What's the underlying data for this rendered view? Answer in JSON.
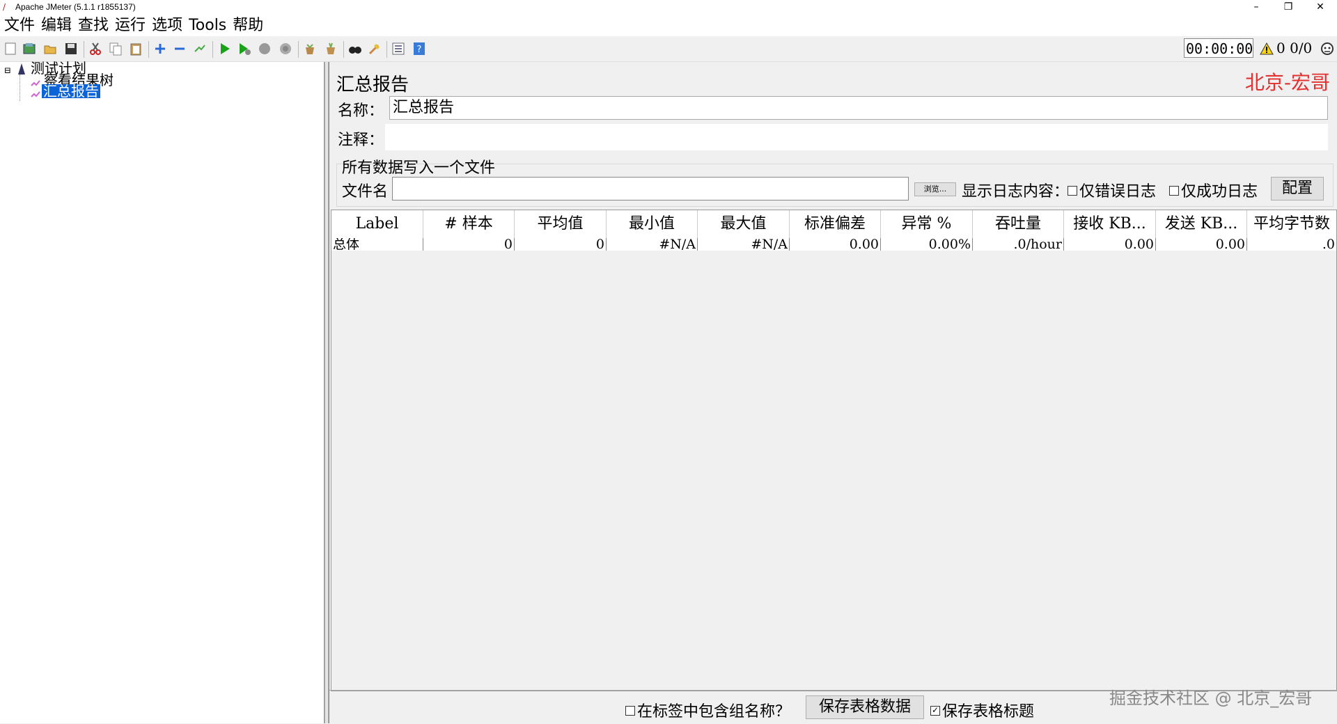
{
  "window": {
    "title": "Apache JMeter (5.1.1 r1855137)",
    "buttons": {
      "minimize": "–",
      "restore": "❐",
      "close": "✕"
    }
  },
  "menu": [
    "文件",
    "编辑",
    "查找",
    "运行",
    "选项",
    "Tools",
    "帮助"
  ],
  "toolbar": {
    "icons": [
      "new-icon",
      "templates-icon",
      "open-icon",
      "save-icon",
      "cut-icon",
      "copy-icon",
      "paste-icon",
      "expand-icon",
      "collapse-icon",
      "toggle-icon",
      "start-icon",
      "start-no-pauses-icon",
      "stop-icon",
      "shutdown-icon",
      "clear-icon",
      "clear-all-icon",
      "search-icon",
      "reset-search-icon",
      "function-helper-icon",
      "help-icon"
    ],
    "timer": "00:00:00",
    "warnings": "0",
    "threads": "0/0"
  },
  "tree": {
    "root": "测试计划",
    "children": [
      "察看结果树",
      "汇总报告"
    ],
    "selected_index": 1
  },
  "panel": {
    "title": "汇总报告",
    "brand": "北京-宏哥",
    "name_label": "名称：",
    "name_value": "汇总报告",
    "comment_label": "注释：",
    "comment_value": "",
    "file_group_title": "所有数据写入一个文件",
    "file_label": "文件名",
    "file_value": "",
    "browse_label": "浏览...",
    "log_label": "显示日志内容：",
    "errors_only": "仅错误日志",
    "success_only": "仅成功日志",
    "configure": "配置"
  },
  "table": {
    "headers": [
      "Label",
      "# 样本",
      "平均值",
      "最小值",
      "最大值",
      "标准偏差",
      "异常 %",
      "吞吐量",
      "接收 KB...",
      "发送 KB...",
      "平均字节数"
    ],
    "rows": [
      [
        "总体",
        "0",
        "0",
        "#N/A",
        "#N/A",
        "0.00",
        "0.00%",
        ".0/hour",
        "0.00",
        "0.00",
        ".0"
      ]
    ]
  },
  "bottom": {
    "include_group": "在标签中包含组名称？",
    "include_group_checked": false,
    "save_data": "保存表格数据",
    "save_header": "保存表格标题",
    "save_header_checked": true
  },
  "watermark": "掘金技术社区 @ 北京_宏哥"
}
